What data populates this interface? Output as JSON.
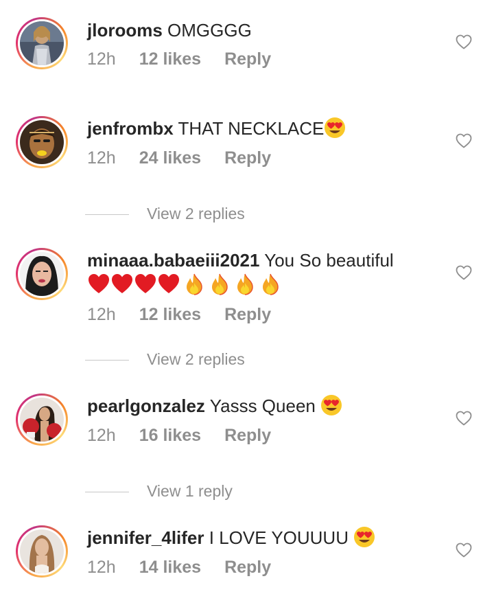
{
  "comments": [
    {
      "username": "jlorooms",
      "text": "OMGGGG",
      "time": "12h",
      "likes": "12 likes",
      "reply": "Reply"
    },
    {
      "username": "jenfrombx",
      "text": "THAT NECKLACE",
      "emoji": "heart-eyes",
      "time": "12h",
      "likes": "24 likes",
      "reply": "Reply",
      "view_replies": "View 2 replies"
    },
    {
      "username": "minaaa.babaeiii2021",
      "text": "You So beautiful",
      "emoji_line": "red-hearts-x4-fire-x4",
      "time": "12h",
      "likes": "12 likes",
      "reply": "Reply",
      "view_replies": "View 2 replies"
    },
    {
      "username": "pearlgonzalez",
      "text": "Yasss Queen",
      "emoji": "heart-eyes",
      "time": "12h",
      "likes": "16 likes",
      "reply": "Reply",
      "view_replies": "View 1 reply"
    },
    {
      "username": "jennifer_4lifer",
      "text": "I LOVE YOUUUU",
      "emoji": "heart-eyes",
      "time": "12h",
      "likes": "14 likes",
      "reply": "Reply"
    }
  ],
  "colors": {
    "text": "#262626",
    "secondary": "#8e8e8e",
    "divider": "#c7c7c7",
    "ring_start": "#f58529",
    "ring_end": "#c13584"
  },
  "icons": {
    "like": "heart-outline-icon",
    "heart_eyes": "smiling-face-with-heart-eyes-emoji",
    "red_heart": "red-heart-emoji",
    "fire": "fire-emoji"
  }
}
